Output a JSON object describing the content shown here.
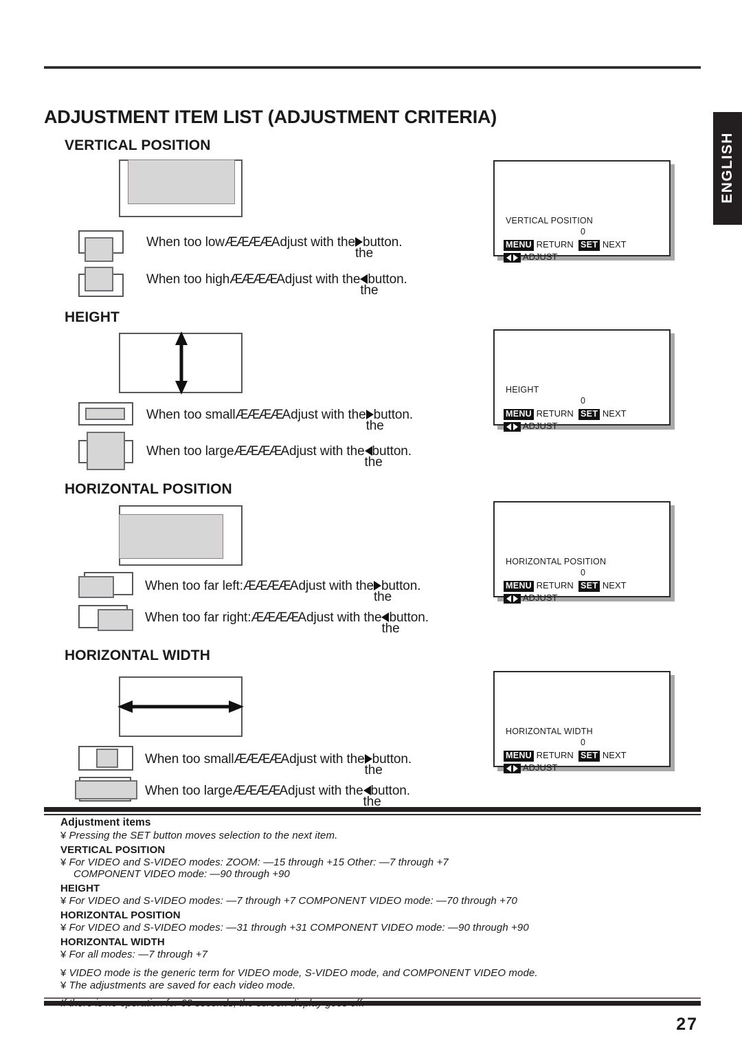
{
  "page": {
    "title": "ADJUSTMENT ITEM LIST (ADJUSTMENT CRITERIA)",
    "number": "27",
    "language_tab": "ENGLISH"
  },
  "sections": [
    {
      "title": "VERTICAL POSITION",
      "captions": [
        {
          "lead": "When too low",
          "dots": "ÆÆÆÆ",
          "tail": "Adjust with the",
          "overlap": "the",
          "button": "▶",
          "end": "button."
        },
        {
          "lead": "When too high",
          "dots": "ÆÆÆÆ",
          "tail": "Adjust with the",
          "overlap": "the",
          "button": "◀",
          "end": "button."
        }
      ],
      "osd": {
        "label": "VERTICAL POSITION",
        "value": "0"
      }
    },
    {
      "title": "HEIGHT",
      "captions": [
        {
          "lead": "When too small",
          "dots": "ÆÆÆÆ",
          "tail": "Adjust with the",
          "overlap": "the",
          "button": "▶",
          "end": "button."
        },
        {
          "lead": "When too large",
          "dots": "ÆÆÆÆ",
          "tail": "Adjust with the",
          "overlap": "the",
          "button": "◀",
          "end": "button."
        }
      ],
      "osd": {
        "label": "HEIGHT",
        "value": "0"
      }
    },
    {
      "title": "HORIZONTAL POSITION",
      "captions": [
        {
          "lead": "When too far left:",
          "dots": "ÆÆÆÆ",
          "tail": "Adjust with the",
          "overlap": "the",
          "button": "▶",
          "end": "button."
        },
        {
          "lead": "When too far right:",
          "dots": "ÆÆÆÆ",
          "tail": "Adjust with the",
          "overlap": "the",
          "button": "◀",
          "end": "button."
        }
      ],
      "osd": {
        "label": "HORIZONTAL POSITION",
        "value": "0"
      }
    },
    {
      "title": "HORIZONTAL WIDTH",
      "captions": [
        {
          "lead": "When too small",
          "dots": "ÆÆÆÆ",
          "tail": "Adjust with the",
          "overlap": "the",
          "button": "▶",
          "end": "button."
        },
        {
          "lead": "When too large",
          "dots": "ÆÆÆÆ",
          "tail": "Adjust with the",
          "overlap": "the",
          "button": "◀",
          "end": "button."
        }
      ],
      "osd": {
        "label": "HORIZONTAL WIDTH",
        "value": "0"
      }
    }
  ],
  "osd_footer": {
    "menu_key": "MENU",
    "return_label": "RETURN",
    "set_key": "SET",
    "next_label": "NEXT",
    "adjust_label": "ADJUST"
  },
  "notes": {
    "heading": "Adjustment items",
    "bullet": "¥",
    "intro": "Pressing the SET button moves selection to the next item.",
    "groups": [
      {
        "title": "VERTICAL POSITION",
        "line": "For VIDEO and S-VIDEO modes: ZOOM: —15 through +15   Other: —7 through +7",
        "cont": "COMPONENT VIDEO mode: —90 through +90"
      },
      {
        "title": "HEIGHT",
        "line": "For VIDEO and S-VIDEO modes: —7 through +7   COMPONENT VIDEO mode: —70 through +70",
        "cont": ""
      },
      {
        "title": "HORIZONTAL POSITION",
        "line": "For VIDEO and S-VIDEO modes: —31 through +31   COMPONENT VIDEO mode: —90 through +90",
        "cont": ""
      },
      {
        "title": "HORIZONTAL WIDTH",
        "line": "For all modes: —7 through +7",
        "cont": ""
      }
    ],
    "generic": "VIDEO mode is the generic term for VIDEO mode, S-VIDEO mode, and COMPONENT VIDEO mode.",
    "saved": "The adjustments are saved for each video mode.",
    "timeout": "If there is no operation for 60 seconds, the screen display goes off."
  },
  "colors": {
    "ink": "#231f20",
    "shade_fill": "#d6d6d6",
    "frame": "#58585b"
  }
}
